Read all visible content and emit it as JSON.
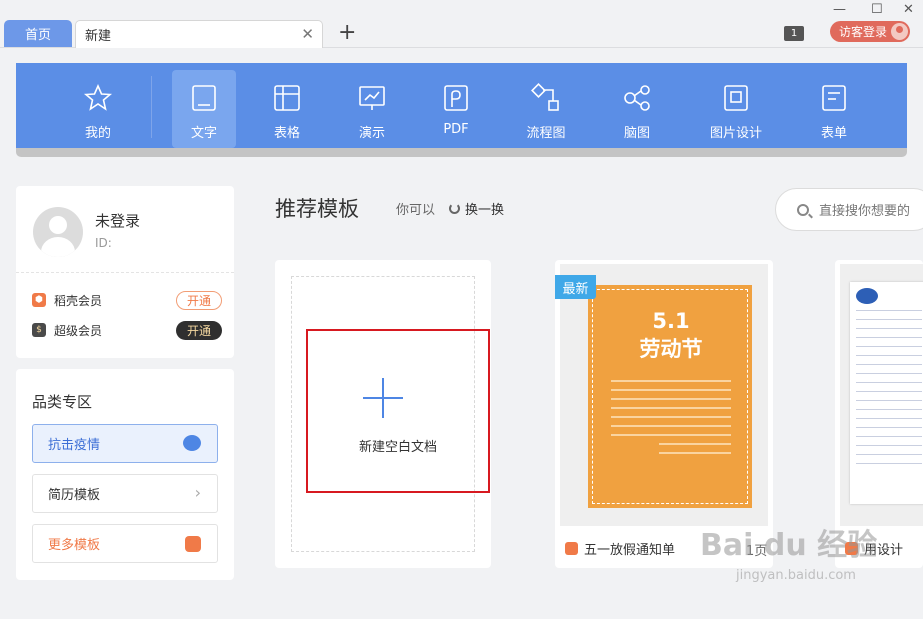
{
  "tabs": {
    "home": "首页",
    "new": "新建",
    "close": "✕",
    "add": "+"
  },
  "window": {
    "badge": "1",
    "login": "访客登录",
    "minimize": "—",
    "maximize": "☐",
    "close": "✕"
  },
  "toolbar": {
    "items": [
      {
        "label": "我的",
        "icon": "star-icon"
      },
      {
        "label": "文字",
        "icon": "document-icon",
        "active": true
      },
      {
        "label": "表格",
        "icon": "table-icon"
      },
      {
        "label": "演示",
        "icon": "presentation-icon"
      },
      {
        "label": "PDF",
        "icon": "pdf-icon"
      },
      {
        "label": "流程图",
        "icon": "flowchart-icon"
      },
      {
        "label": "脑图",
        "icon": "mindmap-icon"
      },
      {
        "label": "图片设计",
        "icon": "image-design-icon"
      },
      {
        "label": "表单",
        "icon": "form-icon"
      }
    ]
  },
  "user": {
    "name": "未登录",
    "id": "ID:",
    "members": [
      {
        "label": "稻壳会员",
        "button": "开通",
        "color": "#f07a48"
      },
      {
        "label": "超级会员",
        "button": "开通",
        "color": "#4a4a4a"
      }
    ]
  },
  "categories": {
    "title": "品类专区",
    "items": [
      {
        "label": "抗击疫情"
      },
      {
        "label": "简历模板",
        "chevron": "›"
      },
      {
        "label": "更多模板"
      }
    ]
  },
  "main": {
    "title": "推荐模板",
    "can": "你可以",
    "refresh": "换一换",
    "search_placeholder": "直接搜你想要的"
  },
  "blank": {
    "label": "新建空白文档"
  },
  "templates": [
    {
      "badge": "最新",
      "name": "五一放假通知单",
      "pages": "1页",
      "poster_title": "5.1\n劳动节"
    },
    {
      "name": "用设计"
    }
  ],
  "watermark": {
    "brand": "Bai du 经验",
    "url": "jingyan.baidu.com"
  }
}
